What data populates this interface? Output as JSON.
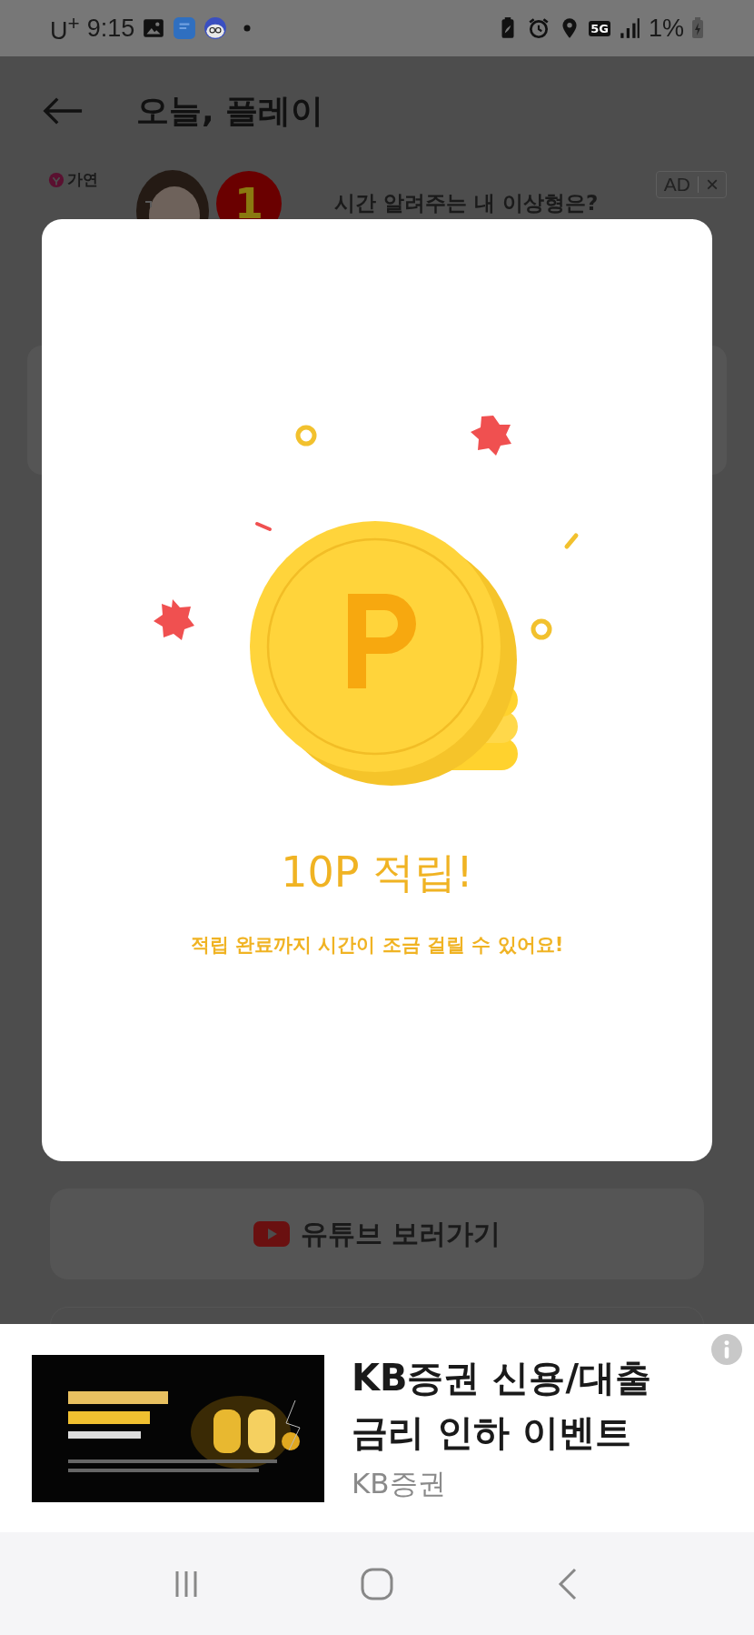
{
  "status_bar": {
    "carrier": "U$^{+}$",
    "time": "9:15",
    "network": "5G",
    "battery": "1%"
  },
  "header": {
    "title": "오늘, 플레이"
  },
  "top_ad": {
    "brand": "가연",
    "rank": "1",
    "ad_label": "AD",
    "close": "×",
    "headline": "시간 알려주는 내 이상형은?"
  },
  "modal": {
    "title": "10P 적립!",
    "message": "적립 완료까지 시간이 조금 걸릴 수 있어요!"
  },
  "youtube_button": {
    "label": "유튜브 보러가기"
  },
  "bottom_ad": {
    "title_lines": [
      "KB증권 신용/대출",
      "금리 인하 이벤트"
    ],
    "advertiser": "KB증권"
  }
}
